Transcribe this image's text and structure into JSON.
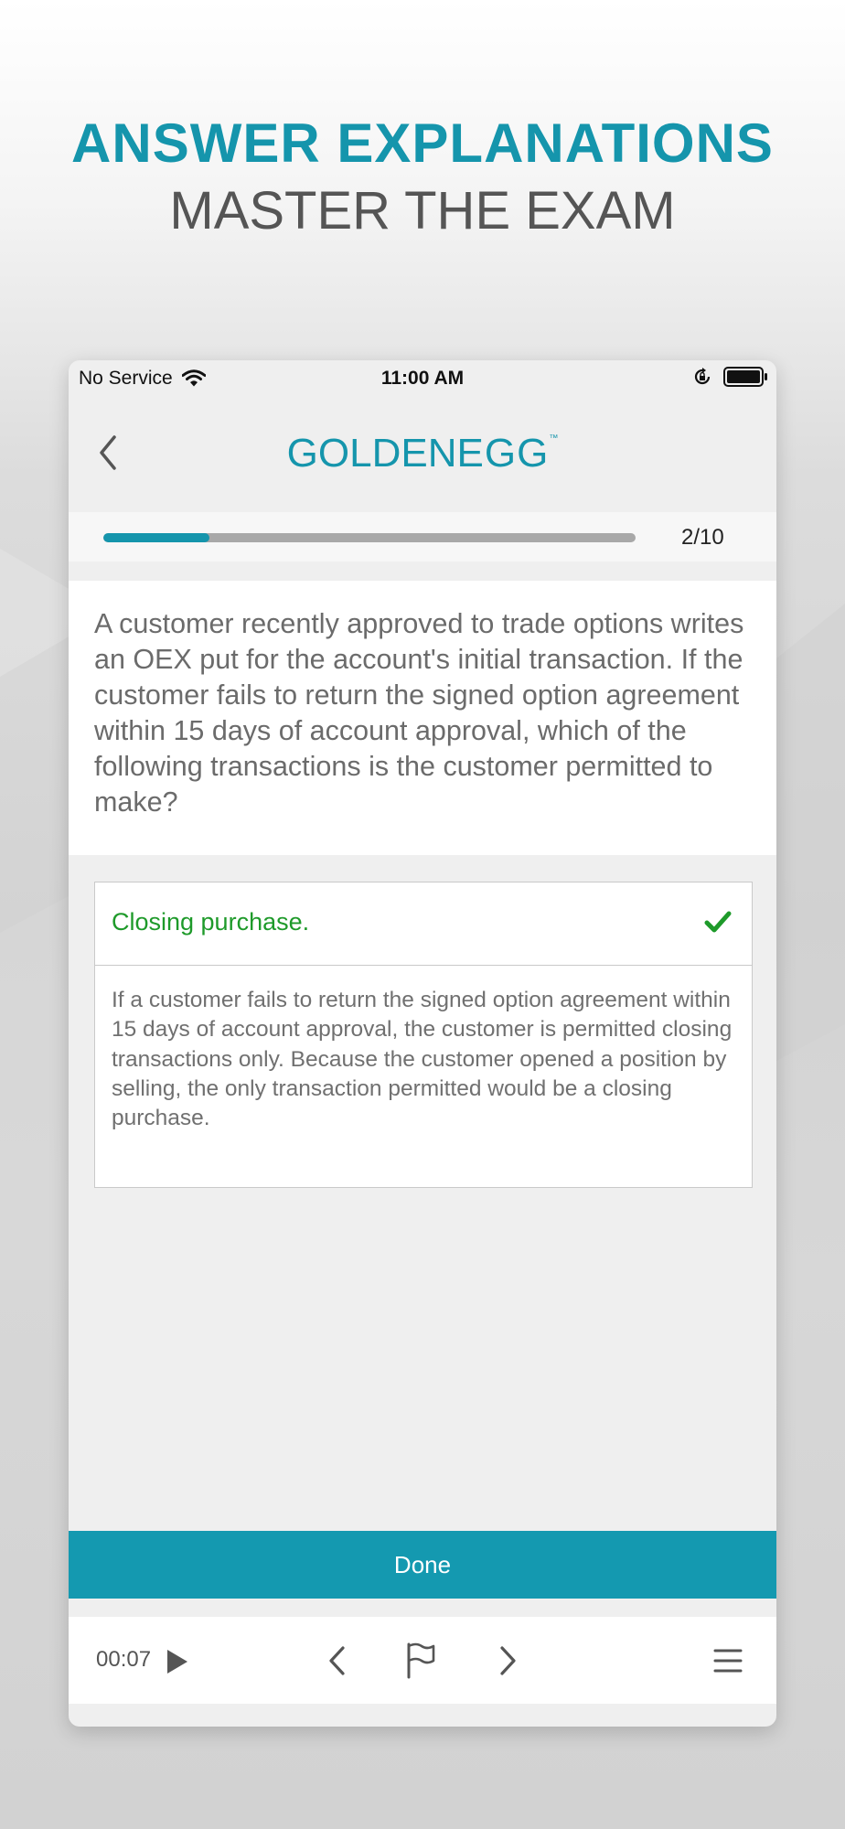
{
  "promo": {
    "title": "ANSWER EXPLANATIONS",
    "subtitle": "MASTER THE EXAM"
  },
  "status_bar": {
    "carrier": "No Service",
    "time": "11:00 AM"
  },
  "header": {
    "logo_gold": "G",
    "logo_o": "O",
    "logo_rest": "LDEN",
    "logo_egg": "EGG",
    "logo_tm": "™"
  },
  "progress": {
    "label": "2/10",
    "fraction": 0.2
  },
  "question": {
    "text": "A customer recently approved to trade options writes an OEX put for the account's initial transaction. If the customer fails to return the signed option agreement within 15 days of account approval, which of the following transactions is the customer permitted to make?"
  },
  "answer": {
    "label": "Closing purchase.",
    "status": "correct",
    "explanation": "If a customer fails to return the signed option agreement within 15 days of account approval, the customer is permitted closing transactions only. Because the customer opened a position by selling, the only transaction permitted would be a closing purchase."
  },
  "actions": {
    "done_label": "Done"
  },
  "toolbar": {
    "timer": "00:07"
  },
  "colors": {
    "accent": "#1595ac",
    "correct": "#1e9a2a",
    "button": "#1499b0"
  },
  "icons": [
    "wifi-icon",
    "orientation-lock-icon",
    "battery-icon",
    "back-chevron-icon",
    "check-icon",
    "play-icon",
    "previous-icon",
    "flag-icon",
    "next-icon",
    "menu-icon"
  ]
}
